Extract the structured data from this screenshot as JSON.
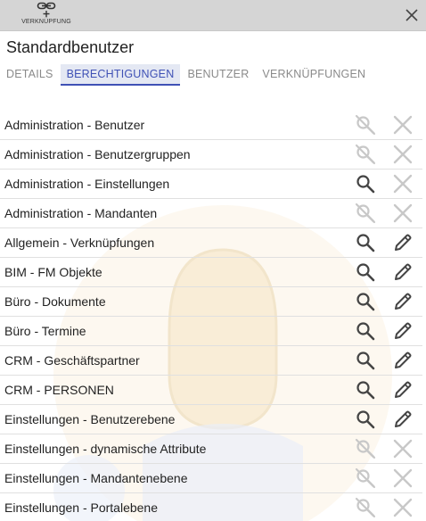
{
  "toolbar": {
    "link_label": "VERKNÜPFUNG"
  },
  "header": {
    "title": "Standardbenutzer"
  },
  "tabs": [
    {
      "label": "DETAILS",
      "active": false
    },
    {
      "label": "BERECHTIGUNGEN",
      "active": true
    },
    {
      "label": "BENUTZER",
      "active": false
    },
    {
      "label": "VERKNÜPFUNGEN",
      "active": false
    }
  ],
  "permissions": [
    {
      "label": "Administration - Benutzer",
      "view": false,
      "edit": false
    },
    {
      "label": "Administration - Benutzergruppen",
      "view": false,
      "edit": false
    },
    {
      "label": "Administration - Einstellungen",
      "view": true,
      "edit": false
    },
    {
      "label": "Administration - Mandanten",
      "view": false,
      "edit": false
    },
    {
      "label": "Allgemein - Verknüpfungen",
      "view": true,
      "edit": true
    },
    {
      "label": "BIM - FM Objekte",
      "view": true,
      "edit": true
    },
    {
      "label": "Büro - Dokumente",
      "view": true,
      "edit": true
    },
    {
      "label": "Büro - Termine",
      "view": true,
      "edit": true
    },
    {
      "label": "CRM - Geschäftspartner",
      "view": true,
      "edit": true
    },
    {
      "label": "CRM - PERSONEN",
      "view": true,
      "edit": true
    },
    {
      "label": "Einstellungen - Benutzerebene",
      "view": true,
      "edit": true
    },
    {
      "label": "Einstellungen - dynamische Attribute",
      "view": false,
      "edit": false
    },
    {
      "label": "Einstellungen - Mandantenebene",
      "view": false,
      "edit": false
    },
    {
      "label": "Einstellungen - Portalebene",
      "view": false,
      "edit": false
    }
  ],
  "colors": {
    "accent": "#3f51b5",
    "icon_active": "#444444",
    "icon_disabled": "#c8c8c8",
    "topbar": "#d5d5d5"
  }
}
